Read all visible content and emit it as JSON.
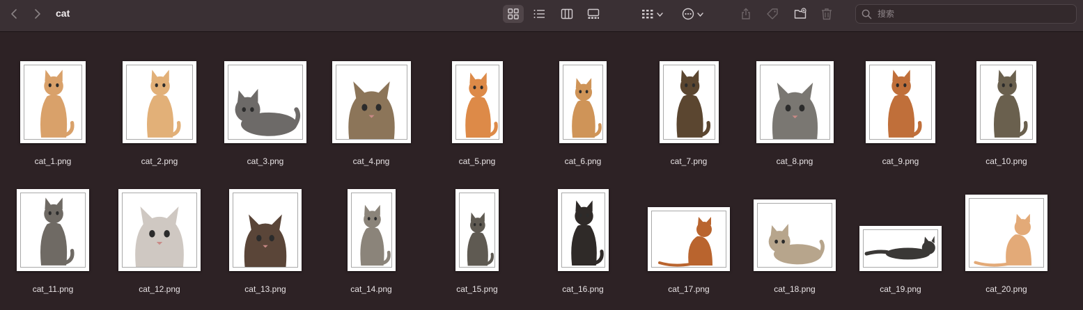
{
  "window": {
    "folder_title": "cat"
  },
  "toolbar": {
    "back_icon": "chevron-left-icon",
    "forward_icon": "chevron-right-icon",
    "view_modes": [
      "icon-view",
      "list-view",
      "column-view",
      "gallery-view"
    ],
    "active_view": "icon-view",
    "group_icon": "group-grid-icon",
    "more_icon": "ellipsis-circle-icon",
    "actions": [
      "share-icon",
      "tag-icon",
      "new-folder-icon",
      "trash-icon"
    ]
  },
  "search": {
    "placeholder": "搜索"
  },
  "files": [
    {
      "name": "cat_1.png",
      "color": "#d9a16a"
    },
    {
      "name": "cat_2.png",
      "color": "#e2b078"
    },
    {
      "name": "cat_3.png",
      "color": "#6d6a68"
    },
    {
      "name": "cat_4.png",
      "color": "#8c7559"
    },
    {
      "name": "cat_5.png",
      "color": "#dd8a48"
    },
    {
      "name": "cat_6.png",
      "color": "#cf9458"
    },
    {
      "name": "cat_7.png",
      "color": "#5b4630"
    },
    {
      "name": "cat_8.png",
      "color": "#7a7772"
    },
    {
      "name": "cat_9.png",
      "color": "#c06f3a"
    },
    {
      "name": "cat_10.png",
      "color": "#6a604e"
    },
    {
      "name": "cat_11.png",
      "color": "#6f6a64"
    },
    {
      "name": "cat_12.png",
      "color": "#cfc8c2"
    },
    {
      "name": "cat_13.png",
      "color": "#5a4538"
    },
    {
      "name": "cat_14.png",
      "color": "#8b847a"
    },
    {
      "name": "cat_15.png",
      "color": "#5f5a52"
    },
    {
      "name": "cat_16.png",
      "color": "#2f2a28"
    },
    {
      "name": "cat_17.png",
      "color": "#b9642e"
    },
    {
      "name": "cat_18.png",
      "color": "#b7a58c"
    },
    {
      "name": "cat_19.png",
      "color": "#3a3836"
    },
    {
      "name": "cat_20.png",
      "color": "#e3aa78"
    }
  ]
}
